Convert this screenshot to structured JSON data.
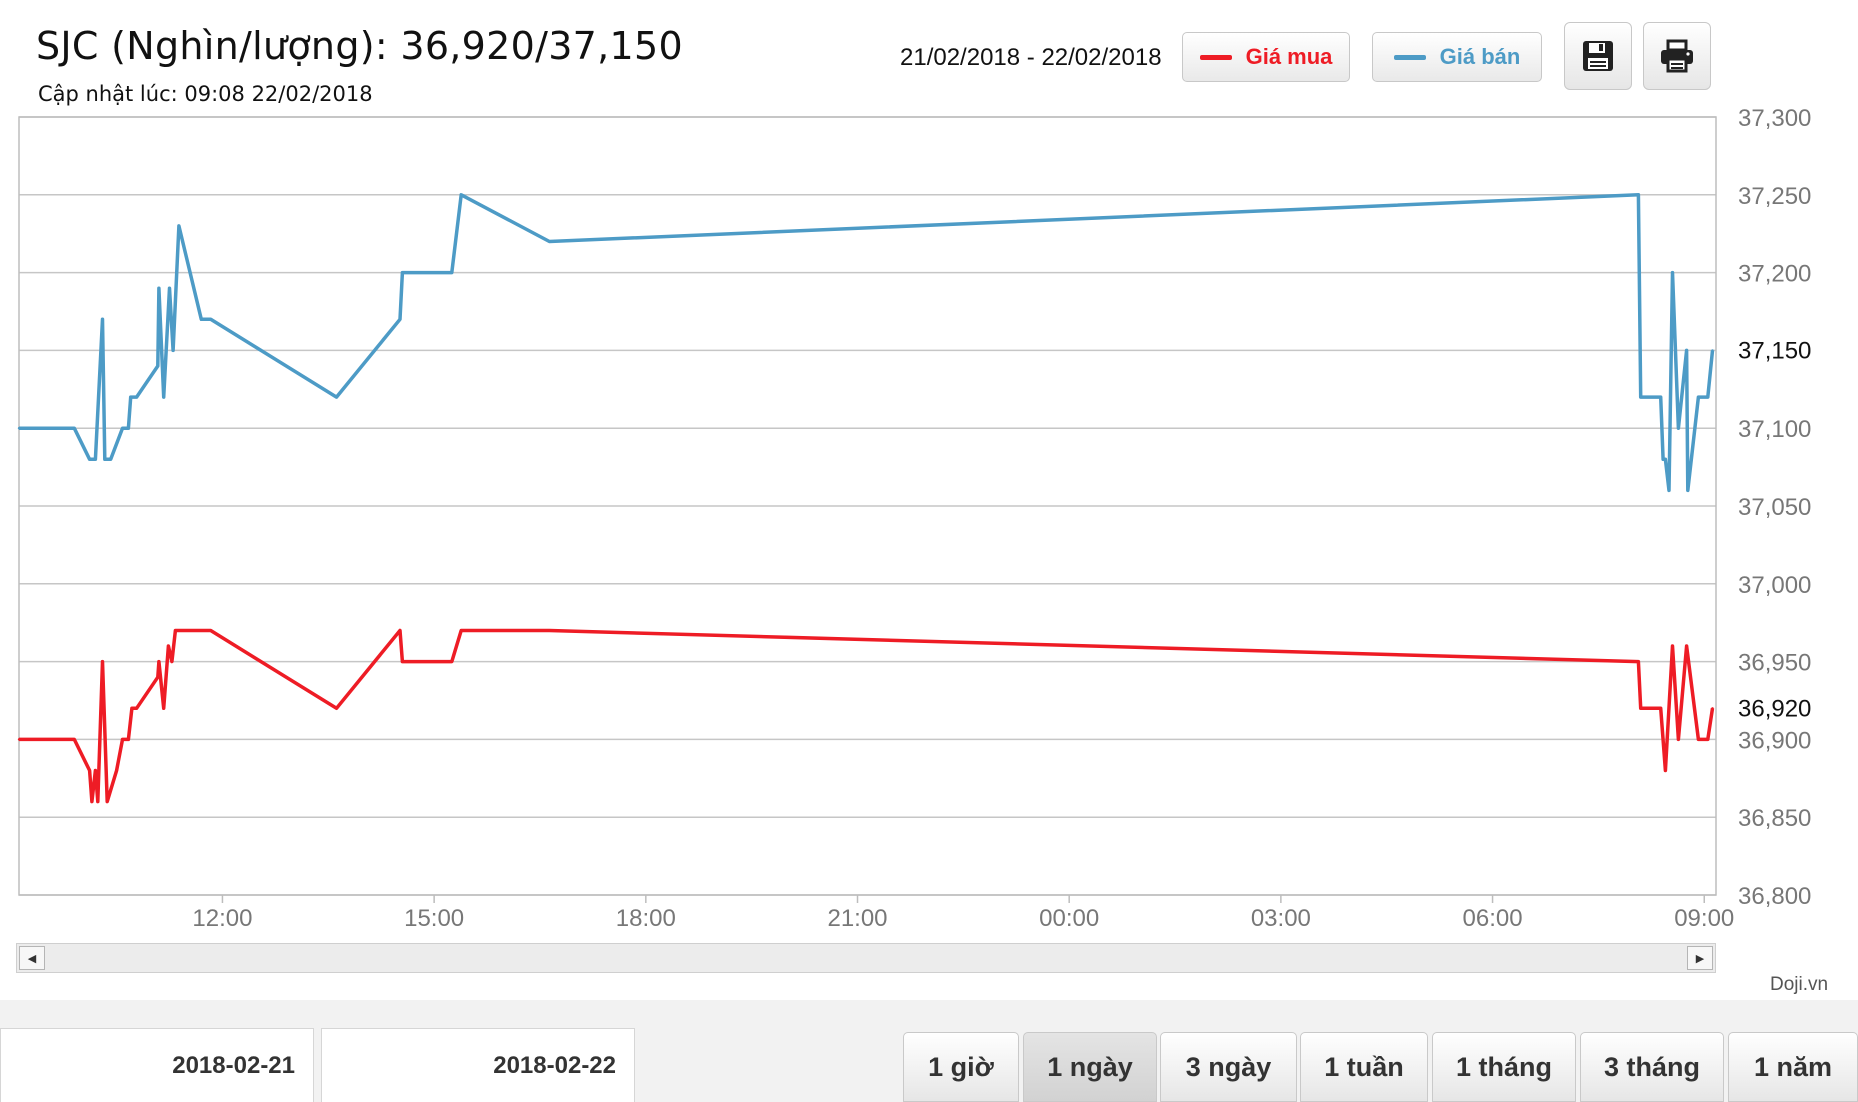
{
  "header": {
    "title": "SJC (Nghìn/lượng): 36,920/37,150",
    "updated": "Cập nhật lúc: 09:08 22/02/2018",
    "date_range": "21/02/2018 - 22/02/2018"
  },
  "legend": {
    "buy_label": "Giá mua",
    "sell_label": "Giá bán",
    "buy_color": "#ee1c25",
    "sell_color": "#4d9bc6"
  },
  "toolbar": {
    "save_icon": "floppy-disk-icon",
    "print_icon": "printer-icon"
  },
  "credit": "Doji.vn",
  "date_tabs": [
    "2018-02-21",
    "2018-02-22"
  ],
  "range_buttons": [
    {
      "label": "1 giờ",
      "active": false
    },
    {
      "label": "1 ngày",
      "active": true
    },
    {
      "label": "3 ngày",
      "active": false
    },
    {
      "label": "1 tuần",
      "active": false
    },
    {
      "label": "1 tháng",
      "active": false
    },
    {
      "label": "3 tháng",
      "active": false
    },
    {
      "label": "1 năm",
      "active": false
    }
  ],
  "chart_data": {
    "type": "line",
    "x_axis": {
      "start": "2018-02-21 09:07",
      "end": "2018-02-22 09:10",
      "ticks": [
        {
          "time": "2018-02-21 12:00",
          "label": "12:00"
        },
        {
          "time": "2018-02-21 15:00",
          "label": "15:00"
        },
        {
          "time": "2018-02-21 18:00",
          "label": "18:00"
        },
        {
          "time": "2018-02-21 21:00",
          "label": "21:00"
        },
        {
          "time": "2018-02-22 00:00",
          "label": "00:00"
        },
        {
          "time": "2018-02-22 03:00",
          "label": "03:00"
        },
        {
          "time": "2018-02-22 06:00",
          "label": "06:00"
        },
        {
          "time": "2018-02-22 09:00",
          "label": "09:00"
        }
      ]
    },
    "y_axis": {
      "min": 36800,
      "max": 37300,
      "ticks": [
        36800,
        36850,
        36900,
        36950,
        37000,
        37050,
        37100,
        37150,
        37200,
        37250,
        37300
      ],
      "tick_labels": [
        "36,800",
        "36,850",
        "36,900",
        "36,950",
        "37,000",
        "37,050",
        "37,100",
        "37,150",
        "37,200",
        "37,250",
        "37,300"
      ],
      "position": "right"
    },
    "grid": true,
    "current_values": [
      {
        "value": 36920,
        "label": "36,920"
      },
      {
        "value": 37150,
        "label": "37,150"
      }
    ],
    "series": [
      {
        "name": "Giá bán",
        "color": "#4d9bc6",
        "points": [
          [
            "2018-02-21 09:07",
            37100
          ],
          [
            "2018-02-21 09:54",
            37100
          ],
          [
            "2018-02-21 10:07",
            37080
          ],
          [
            "2018-02-21 10:12",
            37080
          ],
          [
            "2018-02-21 10:18",
            37170
          ],
          [
            "2018-02-21 10:20",
            37080
          ],
          [
            "2018-02-21 10:25",
            37080
          ],
          [
            "2018-02-21 10:35",
            37100
          ],
          [
            "2018-02-21 10:40",
            37100
          ],
          [
            "2018-02-21 10:42",
            37120
          ],
          [
            "2018-02-21 10:47",
            37120
          ],
          [
            "2018-02-21 11:05",
            37140
          ],
          [
            "2018-02-21 11:06",
            37190
          ],
          [
            "2018-02-21 11:10",
            37120
          ],
          [
            "2018-02-21 11:15",
            37190
          ],
          [
            "2018-02-21 11:18",
            37150
          ],
          [
            "2018-02-21 11:23",
            37230
          ],
          [
            "2018-02-21 11:42",
            37170
          ],
          [
            "2018-02-21 11:50",
            37170
          ],
          [
            "2018-02-21 13:37",
            37120
          ],
          [
            "2018-02-21 14:31",
            37170
          ],
          [
            "2018-02-21 14:33",
            37200
          ],
          [
            "2018-02-21 15:15",
            37200
          ],
          [
            "2018-02-21 15:23",
            37250
          ],
          [
            "2018-02-21 16:38",
            37220
          ],
          [
            "2018-02-22 08:04",
            37250
          ],
          [
            "2018-02-22 08:06",
            37120
          ],
          [
            "2018-02-22 08:23",
            37120
          ],
          [
            "2018-02-22 08:25",
            37080
          ],
          [
            "2018-02-22 08:27",
            37080
          ],
          [
            "2018-02-22 08:30",
            37060
          ],
          [
            "2018-02-22 08:33",
            37200
          ],
          [
            "2018-02-22 08:38",
            37100
          ],
          [
            "2018-02-22 08:45",
            37150
          ],
          [
            "2018-02-22 08:46",
            37060
          ],
          [
            "2018-02-22 08:55",
            37120
          ],
          [
            "2018-02-22 09:03",
            37120
          ],
          [
            "2018-02-22 09:07",
            37150
          ]
        ]
      },
      {
        "name": "Giá mua",
        "color": "#ee1c25",
        "points": [
          [
            "2018-02-21 09:07",
            36900
          ],
          [
            "2018-02-21 09:54",
            36900
          ],
          [
            "2018-02-21 10:07",
            36880
          ],
          [
            "2018-02-21 10:09",
            36860
          ],
          [
            "2018-02-21 10:12",
            36880
          ],
          [
            "2018-02-21 10:14",
            36860
          ],
          [
            "2018-02-21 10:18",
            36950
          ],
          [
            "2018-02-21 10:22",
            36860
          ],
          [
            "2018-02-21 10:30",
            36880
          ],
          [
            "2018-02-21 10:35",
            36900
          ],
          [
            "2018-02-21 10:40",
            36900
          ],
          [
            "2018-02-21 10:43",
            36920
          ],
          [
            "2018-02-21 10:47",
            36920
          ],
          [
            "2018-02-21 11:05",
            36940
          ],
          [
            "2018-02-21 11:06",
            36950
          ],
          [
            "2018-02-21 11:10",
            36920
          ],
          [
            "2018-02-21 11:14",
            36960
          ],
          [
            "2018-02-21 11:17",
            36950
          ],
          [
            "2018-02-21 11:20",
            36970
          ],
          [
            "2018-02-21 11:50",
            36970
          ],
          [
            "2018-02-21 13:37",
            36920
          ],
          [
            "2018-02-21 14:31",
            36970
          ],
          [
            "2018-02-21 14:33",
            36950
          ],
          [
            "2018-02-21 15:15",
            36950
          ],
          [
            "2018-02-21 15:23",
            36970
          ],
          [
            "2018-02-21 16:38",
            36970
          ],
          [
            "2018-02-22 08:04",
            36950
          ],
          [
            "2018-02-22 08:06",
            36920
          ],
          [
            "2018-02-22 08:23",
            36920
          ],
          [
            "2018-02-22 08:27",
            36880
          ],
          [
            "2018-02-22 08:33",
            36960
          ],
          [
            "2018-02-22 08:38",
            36900
          ],
          [
            "2018-02-22 08:45",
            36960
          ],
          [
            "2018-02-22 08:55",
            36900
          ],
          [
            "2018-02-22 09:03",
            36900
          ],
          [
            "2018-02-22 09:07",
            36920
          ]
        ]
      }
    ]
  }
}
